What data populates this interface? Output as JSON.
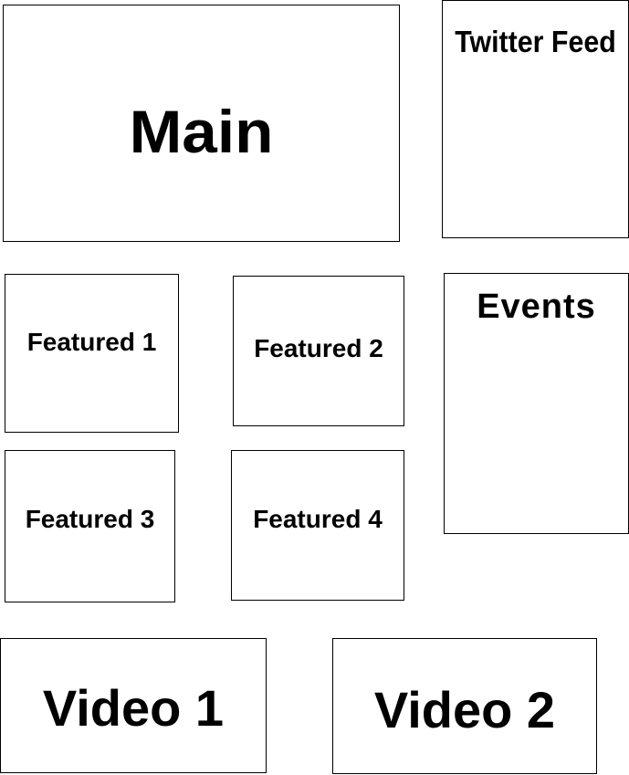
{
  "layout_blocks": {
    "main": "Main",
    "twitter_feed": "Twitter Feed",
    "featured_1": "Featured 1",
    "featured_2": "Featured 2",
    "featured_3": "Featured 3",
    "featured_4": "Featured 4",
    "events": "Events",
    "video_1": "Video 1",
    "video_2": "Video 2"
  },
  "colors": {
    "border": "#000000",
    "text": "#000000",
    "background": "#ffffff"
  }
}
